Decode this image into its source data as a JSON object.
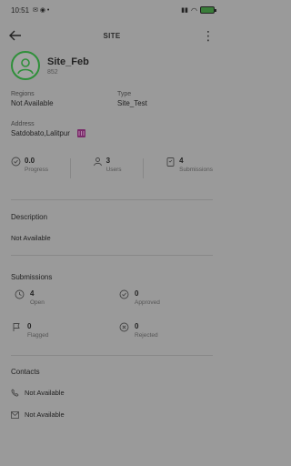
{
  "status_bar": {
    "time": "10:51",
    "battery": ""
  },
  "app_bar": {
    "title": "SITE"
  },
  "site": {
    "name": "Site_Feb",
    "code": "852"
  },
  "fields": {
    "regions_label": "Regions",
    "regions_value": "Not Available",
    "type_label": "Type",
    "type_value": "Site_Test",
    "address_label": "Address",
    "address_value": "Satdobato,Lalitpur"
  },
  "stats": [
    {
      "value": "0.0",
      "label": "Progress",
      "icon": "progress-icon"
    },
    {
      "value": "3",
      "label": "Users",
      "icon": "users-icon"
    },
    {
      "value": "4",
      "label": "Submissions",
      "icon": "clipboard-icon"
    }
  ],
  "description": {
    "title": "Description",
    "value": "Not Available"
  },
  "submissions": {
    "title": "Submissions",
    "items": [
      {
        "value": "4",
        "label": "Open",
        "icon": "clock-icon"
      },
      {
        "value": "0",
        "label": "Approved",
        "icon": "check-circle-icon"
      },
      {
        "value": "0",
        "label": "Flagged",
        "icon": "flag-icon"
      },
      {
        "value": "0",
        "label": "Rejected",
        "icon": "x-circle-icon"
      }
    ]
  },
  "contacts": {
    "title": "Contacts",
    "phone": "Not Available",
    "email": "Not Available"
  },
  "colors": {
    "accent": "#2f8f3a",
    "map_pin": "#7a2a6a",
    "overlay_bg": "#9a9a9a"
  }
}
